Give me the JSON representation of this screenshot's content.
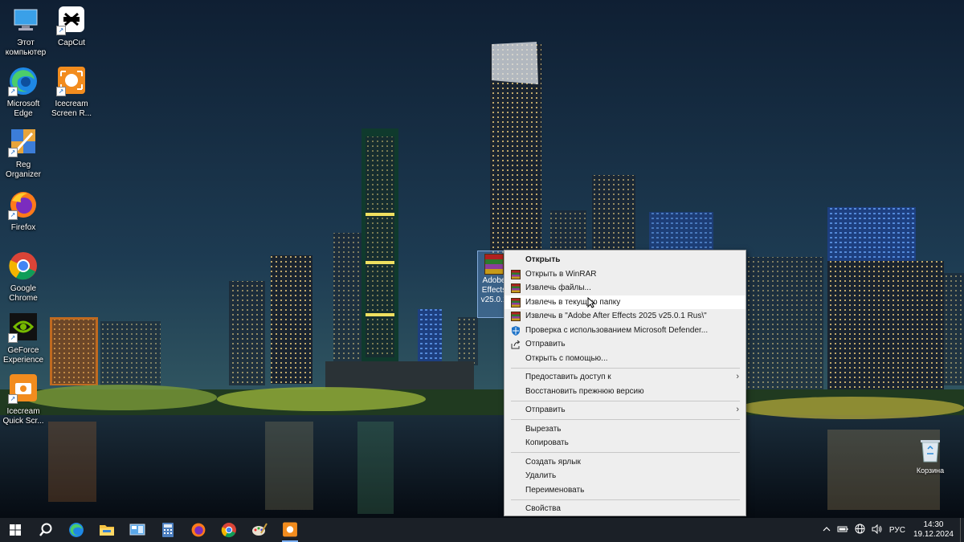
{
  "desktop": {
    "icons": [
      {
        "label": "Этот компьютер"
      },
      {
        "label": "CapCut"
      },
      {
        "label": "Microsoft Edge"
      },
      {
        "label": "Icecream Screen R..."
      },
      {
        "label": "Reg Organizer"
      },
      {
        "label": "Firefox"
      },
      {
        "label": "Google Chrome"
      },
      {
        "label": "GeForce Experience"
      },
      {
        "label": "Icecream Quick Scr..."
      }
    ],
    "selected_file": {
      "label": "Adobe Effects v25.0.1"
    },
    "recycle_bin": {
      "label": "Корзина"
    }
  },
  "context_menu": {
    "items": [
      {
        "label": "Открыть",
        "bold": true
      },
      {
        "label": "Открыть в WinRAR",
        "icon": "winrar-icon"
      },
      {
        "label": "Извлечь файлы...",
        "icon": "winrar-icon"
      },
      {
        "label": "Извлечь в текущую папку",
        "icon": "winrar-icon",
        "hover": true
      },
      {
        "label": "Извлечь в \"Adobe After Effects 2025 v25.0.1 Rus\\\"",
        "icon": "winrar-icon"
      },
      {
        "label": "Проверка с использованием Microsoft Defender...",
        "icon": "defender-icon"
      },
      {
        "label": "Отправить",
        "icon": "share-icon"
      },
      {
        "label": "Открыть с помощью..."
      },
      {
        "label": "Предоставить доступ к",
        "submenu": true
      },
      {
        "label": "Восстановить прежнюю версию"
      },
      {
        "label": "Отправить",
        "submenu": true
      },
      {
        "label": "Вырезать"
      },
      {
        "label": "Копировать"
      },
      {
        "label": "Создать ярлык"
      },
      {
        "label": "Удалить"
      },
      {
        "label": "Переименовать"
      },
      {
        "label": "Свойства"
      }
    ]
  },
  "taskbar": {
    "language": "РУС",
    "time": "14:30",
    "date": "19.12.2024"
  },
  "colors": {
    "menu_bg": "#eeeeee",
    "menu_hover": "#ffffff",
    "taskbar_bg": "#1b2027",
    "accent": "#7fb3ff"
  }
}
